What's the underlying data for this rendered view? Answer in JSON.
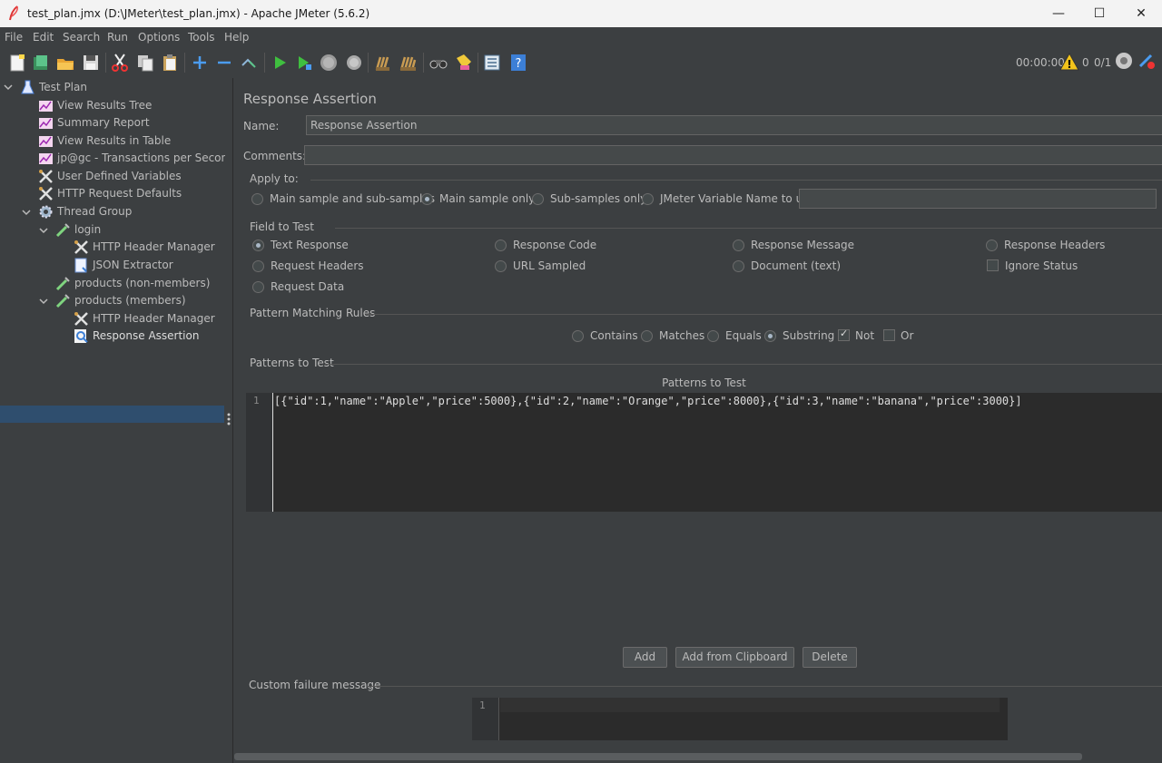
{
  "window": {
    "title": "test_plan.jmx (D:\\JMeter\\test_plan.jmx) - Apache JMeter (5.6.2)",
    "minimize": "—",
    "maximize": "☐",
    "close": "✕"
  },
  "menu": {
    "file": "File",
    "edit": "Edit",
    "search": "Search",
    "run": "Run",
    "options": "Options",
    "tools": "Tools",
    "help": "Help"
  },
  "toolbar": {
    "elapsed": "00:00:00",
    "warnings": "0",
    "threads": "0/1"
  },
  "tree": {
    "items": [
      {
        "label": "Test Plan",
        "icon": "test-plan-icon"
      },
      {
        "label": "View Results Tree",
        "icon": "listener-graph-icon"
      },
      {
        "label": "Summary Report",
        "icon": "listener-graph-icon"
      },
      {
        "label": "View Results in Table",
        "icon": "listener-graph-icon"
      },
      {
        "label": "jp@gc - Transactions per Second",
        "icon": "listener-graph-icon"
      },
      {
        "label": "User Defined Variables",
        "icon": "config-tools-icon"
      },
      {
        "label": "HTTP Request Defaults",
        "icon": "config-tools-icon"
      },
      {
        "label": "Thread Group",
        "icon": "gear-icon"
      },
      {
        "label": "login",
        "icon": "sampler-pipette-icon"
      },
      {
        "label": "HTTP Header Manager",
        "icon": "config-tools-icon"
      },
      {
        "label": "JSON Extractor",
        "icon": "extractor-icon"
      },
      {
        "label": "products (non-members)",
        "icon": "sampler-pipette-icon"
      },
      {
        "label": "products (members)",
        "icon": "sampler-pipette-icon"
      },
      {
        "label": "HTTP Header Manager",
        "icon": "config-tools-icon"
      },
      {
        "label": "Response Assertion",
        "icon": "assertion-magnifier-icon"
      }
    ]
  },
  "panel": {
    "title": "Response Assertion",
    "name_label": "Name:",
    "name_value": "Response Assertion",
    "comments_label": "Comments:",
    "comments_value": "",
    "apply_to": {
      "label": "Apply to:",
      "options": [
        "Main sample and sub-samples",
        "Main sample only",
        "Sub-samples only",
        "JMeter Variable Name to use"
      ],
      "selected": "Main sample only",
      "variable_value": ""
    },
    "field_to_test": {
      "label": "Field to Test",
      "options": [
        "Text Response",
        "Response Code",
        "Response Message",
        "Response Headers",
        "Request Headers",
        "URL Sampled",
        "Document (text)",
        "Ignore Status",
        "Request Data"
      ],
      "selected": "Text Response",
      "ignore_status_checked": false
    },
    "pattern_matching": {
      "label": "Pattern Matching Rules",
      "options": [
        "Contains",
        "Matches",
        "Equals",
        "Substring",
        "Not",
        "Or"
      ],
      "selected": "Substring",
      "not_checked": true,
      "or_checked": false
    },
    "patterns": {
      "label": "Patterns to Test",
      "column_header": "Patterns to Test",
      "line_number": "1",
      "value": "[{\"id\":1,\"name\":\"Apple\",\"price\":5000},{\"id\":2,\"name\":\"Orange\",\"price\":8000},{\"id\":3,\"name\":\"banana\",\"price\":3000}]"
    },
    "buttons": {
      "add": "Add",
      "add_clipboard": "Add from Clipboard",
      "delete": "Delete"
    },
    "custom_failure": {
      "label": "Custom failure message",
      "line_number": "1",
      "value": ""
    }
  }
}
